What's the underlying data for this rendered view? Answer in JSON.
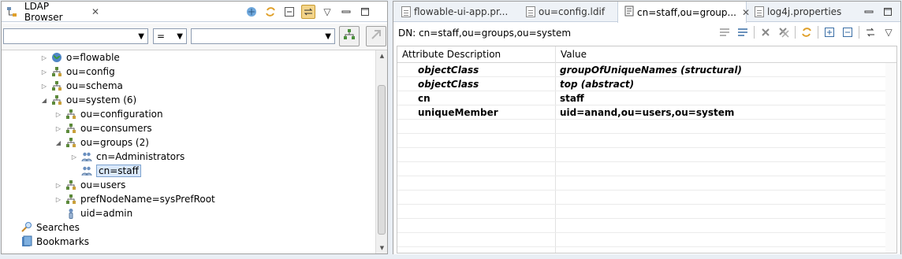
{
  "left_view": {
    "tab_title": "LDAP Browser",
    "close_glyph": "✕",
    "toolbar_icons": [
      "link-with-editor-icon",
      "refresh-icon",
      "collapse-all-icon",
      "link-pressed-icon",
      "view-menu-icon",
      "minimize-icon",
      "maximize-icon"
    ],
    "filter": {
      "attribute_value": "",
      "operator_value": "=",
      "value_value": ""
    },
    "tree": [
      {
        "label": "o=flowable",
        "depth": 2,
        "twisty": "collapsed",
        "icon": "globe-icon"
      },
      {
        "label": "ou=config",
        "depth": 2,
        "twisty": "collapsed",
        "icon": "org-unit-icon"
      },
      {
        "label": "ou=schema",
        "depth": 2,
        "twisty": "collapsed",
        "icon": "org-unit-icon"
      },
      {
        "label": "ou=system (6)",
        "depth": 2,
        "twisty": "expanded",
        "icon": "org-unit-icon"
      },
      {
        "label": "ou=configuration",
        "depth": 3,
        "twisty": "collapsed",
        "icon": "org-unit-icon"
      },
      {
        "label": "ou=consumers",
        "depth": 3,
        "twisty": "collapsed",
        "icon": "org-unit-icon"
      },
      {
        "label": "ou=groups (2)",
        "depth": 3,
        "twisty": "expanded",
        "icon": "org-unit-icon"
      },
      {
        "label": "cn=Administrators",
        "depth": 4,
        "twisty": "collapsed",
        "icon": "group-icon"
      },
      {
        "label": "cn=staff",
        "depth": 4,
        "twisty": "none",
        "icon": "group-icon",
        "selected": true
      },
      {
        "label": "ou=users",
        "depth": 3,
        "twisty": "collapsed",
        "icon": "org-unit-icon"
      },
      {
        "label": "prefNodeName=sysPrefRoot",
        "depth": 3,
        "twisty": "collapsed",
        "icon": "org-unit-icon"
      },
      {
        "label": "uid=admin",
        "depth": 3,
        "twisty": "none",
        "icon": "person-icon"
      },
      {
        "label": "Searches",
        "depth": 0,
        "twisty": "none",
        "icon": "searches-icon"
      },
      {
        "label": "Bookmarks",
        "depth": 0,
        "twisty": "none",
        "icon": "bookmarks-icon"
      }
    ]
  },
  "editor": {
    "tabs": [
      {
        "label": "flowable-ui-app.pr...",
        "active": false
      },
      {
        "label": "ou=config.ldif",
        "active": false
      },
      {
        "label": "cn=staff,ou=group...",
        "active": true
      },
      {
        "label": "log4j.properties",
        "active": false
      }
    ],
    "dn": "DN: cn=staff,ou=groups,ou=system",
    "columns": [
      "Attribute Description",
      "Value"
    ],
    "rows": [
      {
        "attribute": "objectClass",
        "value": "groupOfUniqueNames (structural)",
        "style": "bold-italic"
      },
      {
        "attribute": "objectClass",
        "value": "top (abstract)",
        "style": "bold-italic"
      },
      {
        "attribute": "cn",
        "value": "staff",
        "style": "bold"
      },
      {
        "attribute": "uniqueMember",
        "value": "uid=anand,ou=users,ou=system",
        "style": "bold"
      }
    ],
    "toolbar_icons": [
      "show-decorated-icon",
      "show-raw-icon",
      "delete-icon",
      "delete-all-icon",
      "refresh-icon",
      "expand-all-icon",
      "collapse-all-icon",
      "link-icon",
      "view-menu-icon"
    ]
  },
  "colors": {
    "selection": "#d9e8fb",
    "selection_border": "#7da2ce",
    "pressed_button": "#f3d48a"
  }
}
